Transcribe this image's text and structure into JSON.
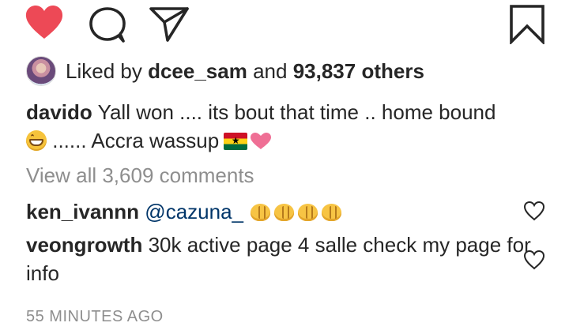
{
  "actions": {
    "like_icon": "heart-filled-icon",
    "comment_icon": "comment-bubble-icon",
    "share_icon": "paper-plane-icon",
    "save_icon": "bookmark-icon",
    "like_color": "#ed4956"
  },
  "likes": {
    "prefix": "Liked by",
    "user": "dcee_sam",
    "joiner": "and",
    "others": "93,837 others"
  },
  "caption": {
    "username": "davido",
    "line1": "Yall won .... its bout that time .. home bound",
    "line2": "...... Accra wassup",
    "emojis": [
      "grinning-face-icon",
      "ghana-flag-icon",
      "pink-heart-icon"
    ]
  },
  "view_all": "View all 3,609 comments",
  "comments": [
    {
      "username": "ken_ivannn",
      "mention": "@cazuna_",
      "text": "",
      "emojis": [
        "folded-hands-icon",
        "folded-hands-icon",
        "folded-hands-icon",
        "folded-hands-icon"
      ]
    },
    {
      "username": "veongrowth",
      "mention": "",
      "text": "30k active page 4 salle check my page for info",
      "emojis": []
    }
  ],
  "timestamp": "55 MINUTES AGO"
}
